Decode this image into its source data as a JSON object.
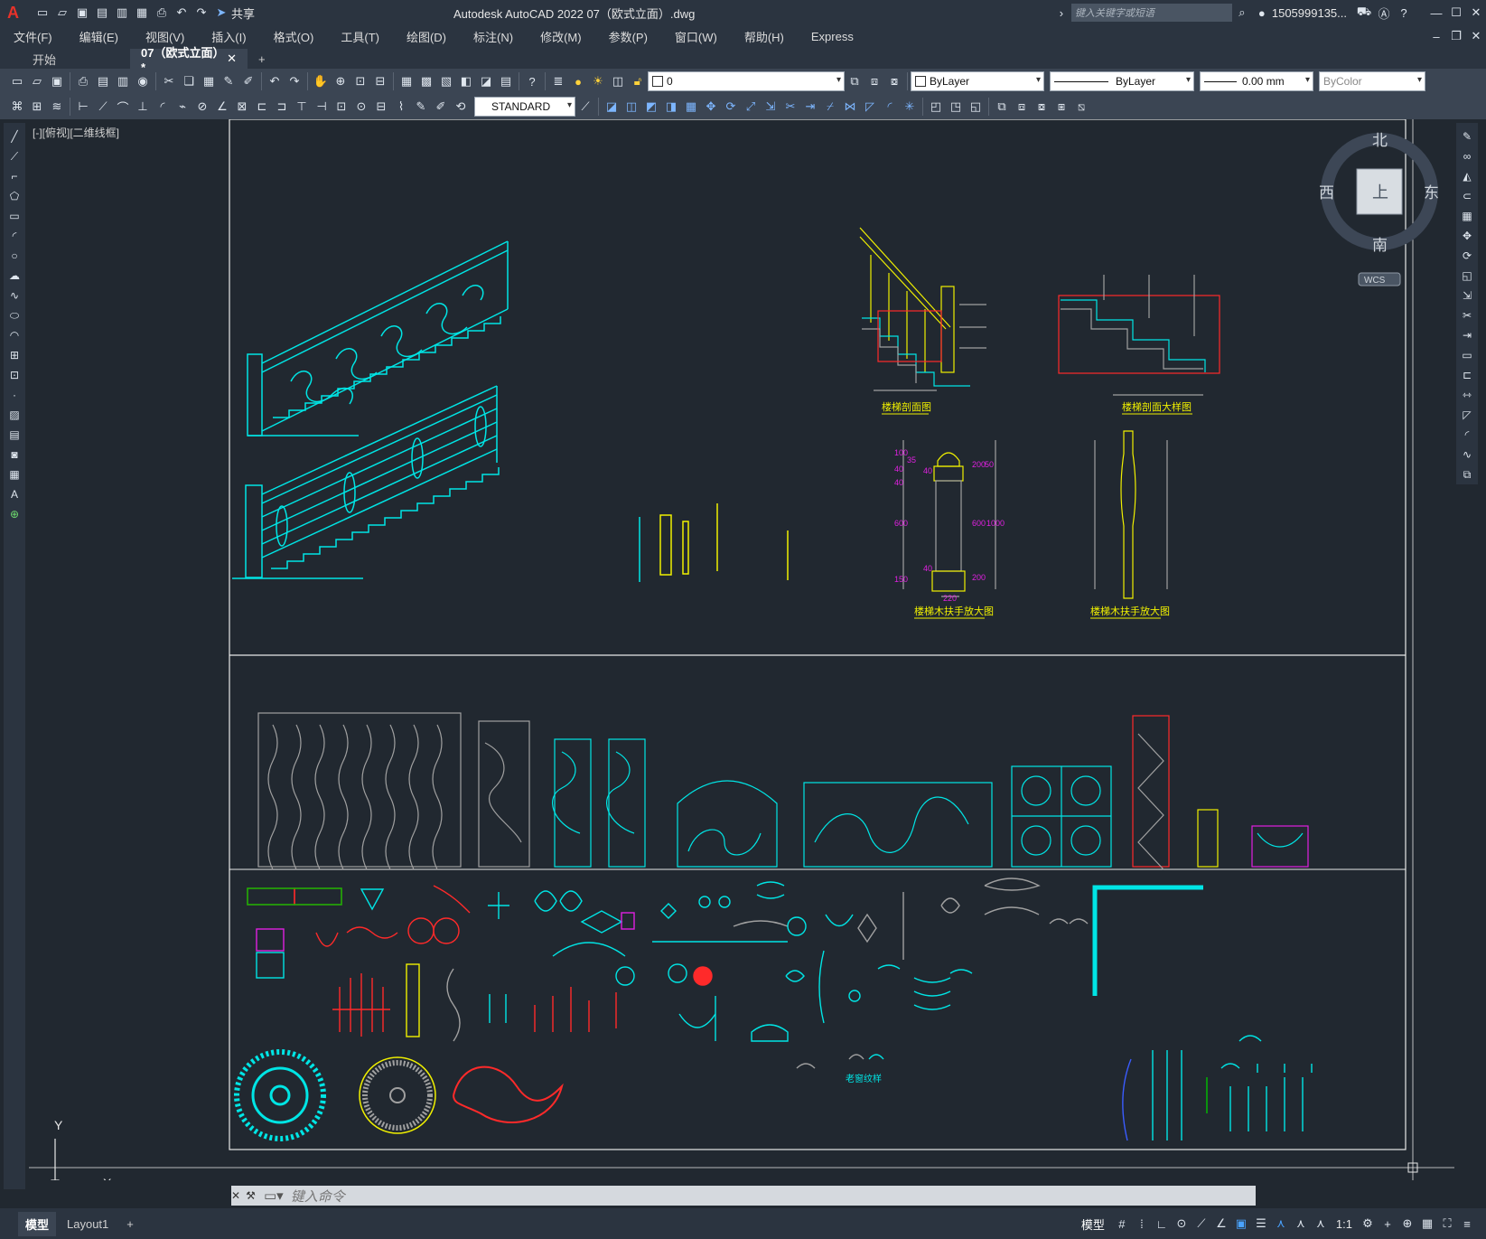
{
  "app": {
    "title": "Autodesk AutoCAD 2022    07（欧式立面）.dwg",
    "share_label": "共享",
    "search_placeholder": "键入关键字或短语",
    "user_label": "1505999135...",
    "logo_letter": "A"
  },
  "menu": {
    "items": [
      "文件(F)",
      "编辑(E)",
      "视图(V)",
      "插入(I)",
      "格式(O)",
      "工具(T)",
      "绘图(D)",
      "标注(N)",
      "修改(M)",
      "参数(P)",
      "窗口(W)",
      "帮助(H)",
      "Express"
    ]
  },
  "tabs": {
    "start": "开始",
    "file": "07（欧式立面）*",
    "add": "+"
  },
  "toolbar": {
    "layer_value": "0",
    "color_value": "ByLayer",
    "linetype_value": "ByLayer",
    "lineweight_value": "0.00 mm",
    "plotstyle_value": "ByColor",
    "textstyle_value": "STANDARD"
  },
  "viewport": {
    "label": "[-][俯视][二维线框]",
    "compass": {
      "north": "北",
      "south": "南",
      "east": "东",
      "west": "西",
      "top": "上"
    },
    "wcs": "WCS",
    "ucs_x": "X",
    "ucs_y": "Y"
  },
  "drawing_labels": {
    "stair_section": "楼梯剖面图",
    "stair_section_detail": "楼梯剖面大样图",
    "newel_post_detail_1": "楼梯木扶手放大图",
    "newel_post_detail_2": "楼梯木扶手放大图",
    "baluster_dims": [
      "100",
      "40",
      "40",
      "35",
      "40",
      "600",
      "150",
      "40",
      "220",
      "1000",
      "200",
      "50",
      "600",
      "200"
    ],
    "small_caption": "老窗纹样"
  },
  "command": {
    "placeholder": "键入命令"
  },
  "status": {
    "layout_tabs": [
      "模型",
      "Layout1"
    ],
    "model_label": "模型",
    "scale": "1:1"
  },
  "colors": {
    "canvas_bg": "#212830",
    "cyan": "#00e5e5",
    "red": "#ff2a2a",
    "yellow": "#f0f000",
    "magenta": "#e020e0",
    "gray": "#a0a0a0",
    "white": "#e8e8e8"
  }
}
